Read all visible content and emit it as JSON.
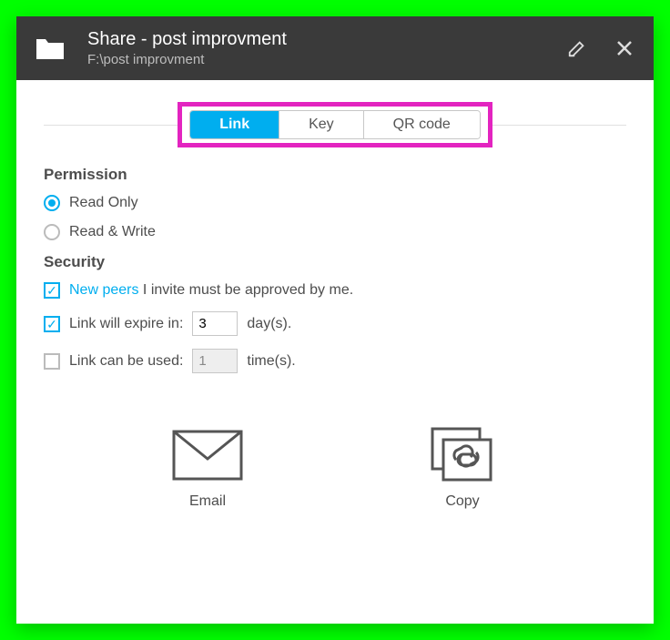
{
  "header": {
    "title": "Share - post improvment",
    "path": "F:\\post improvment"
  },
  "tabs": {
    "link": "Link",
    "key": "Key",
    "qr": "QR code"
  },
  "permission": {
    "heading": "Permission",
    "read_only": "Read Only",
    "read_write": "Read & Write"
  },
  "security": {
    "heading": "Security",
    "new_peers_link": "New peers",
    "new_peers_rest": " I invite must be approved by me.",
    "expire_prefix": "Link will expire in:",
    "expire_value": "3",
    "expire_suffix": "day(s).",
    "uses_prefix": "Link can be used:",
    "uses_value": "1",
    "uses_suffix": "time(s)."
  },
  "actions": {
    "email": "Email",
    "copy": "Copy"
  }
}
